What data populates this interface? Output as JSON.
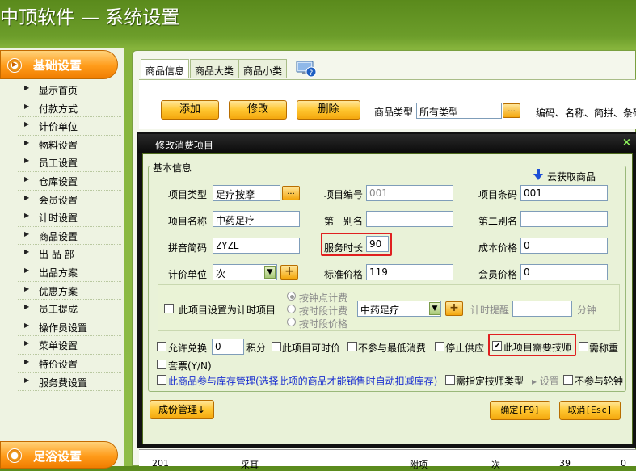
{
  "window": {
    "title": "中顶软件",
    "subtitle": "— 系统设置"
  },
  "sidebar": {
    "header": "基础设置",
    "items": [
      {
        "label": "显示首页"
      },
      {
        "label": "付款方式"
      },
      {
        "label": "计价单位"
      },
      {
        "label": "物料设置"
      },
      {
        "label": "员工设置"
      },
      {
        "label": "仓库设置"
      },
      {
        "label": "会员设置"
      },
      {
        "label": "计时设置"
      },
      {
        "label": "商品设置"
      },
      {
        "label": "出 品 部"
      },
      {
        "label": "出品方案"
      },
      {
        "label": "优惠方案"
      },
      {
        "label": "员工提成"
      },
      {
        "label": "操作员设置"
      },
      {
        "label": "菜单设置"
      },
      {
        "label": "特价设置"
      },
      {
        "label": "服务费设置"
      }
    ],
    "footer": "足浴设置"
  },
  "tabs": [
    {
      "label": "商品信息",
      "active": true
    },
    {
      "label": "商品大类",
      "active": false
    },
    {
      "label": "商品小类",
      "active": false
    }
  ],
  "toolbar": {
    "add": "添加",
    "edit": "修改",
    "delete": "删除",
    "type_label": "商品类型",
    "type_value": "所有类型",
    "dots": "...",
    "search_hint": "编码、名称、简拼、条码"
  },
  "grid_partial": {
    "code": "201",
    "name": "采耳",
    "category": "附项",
    "unit": "次",
    "price": "39",
    "extra": "0"
  },
  "dialog": {
    "title": "修改消费项目",
    "close": "×",
    "group_title": "基本信息",
    "cloud_fetch": "云获取商品",
    "fields": {
      "item_type": {
        "label": "项目类型",
        "value": "足疗按摩"
      },
      "item_no": {
        "label": "项目编号",
        "value": "001"
      },
      "barcode": {
        "label": "项目条码",
        "value": "001"
      },
      "item_name": {
        "label": "项目名称",
        "value": "中药足疗"
      },
      "alias1": {
        "label": "第一别名",
        "value": ""
      },
      "alias2": {
        "label": "第二别名",
        "value": ""
      },
      "pinyin": {
        "label": "拼音简码",
        "value": "ZYZL"
      },
      "duration": {
        "label": "服务时长",
        "value": "90"
      },
      "cost": {
        "label": "成本价格",
        "value": "0"
      },
      "unit": {
        "label": "计价单位",
        "value": "次"
      },
      "std_price": {
        "label": "标准价格",
        "value": "119"
      },
      "member_price": {
        "label": "会员价格",
        "value": "0"
      }
    },
    "timer": {
      "checkbox": "此项目设置为计时项目",
      "radio1": "按钟点计费",
      "radio2": "按时段计费",
      "radio3": "按时段价格",
      "select_value": "中药足疗",
      "remind_label": "计时提醒",
      "remind_unit": "分钟"
    },
    "options": {
      "exchange": "允许兑换",
      "exchange_value": "0",
      "points": "积分",
      "timed_price": "此项目可时价",
      "no_min": "不参与最低消费",
      "stop_supply": "停止供应",
      "need_tech": "此项目需要技师",
      "need_weigh": "需称重",
      "set_meal": "套票(Y/N)",
      "inventory": "此商品参与库存管理(选择此项的商品才能销售时自动扣减库存)",
      "tech_type": "需指定技师类型",
      "setting": "设置",
      "no_rotation": "不参与轮钟"
    },
    "buttons": {
      "components": "成份管理↓",
      "ok": "确定[F9]",
      "cancel": "取消[Esc]"
    }
  }
}
